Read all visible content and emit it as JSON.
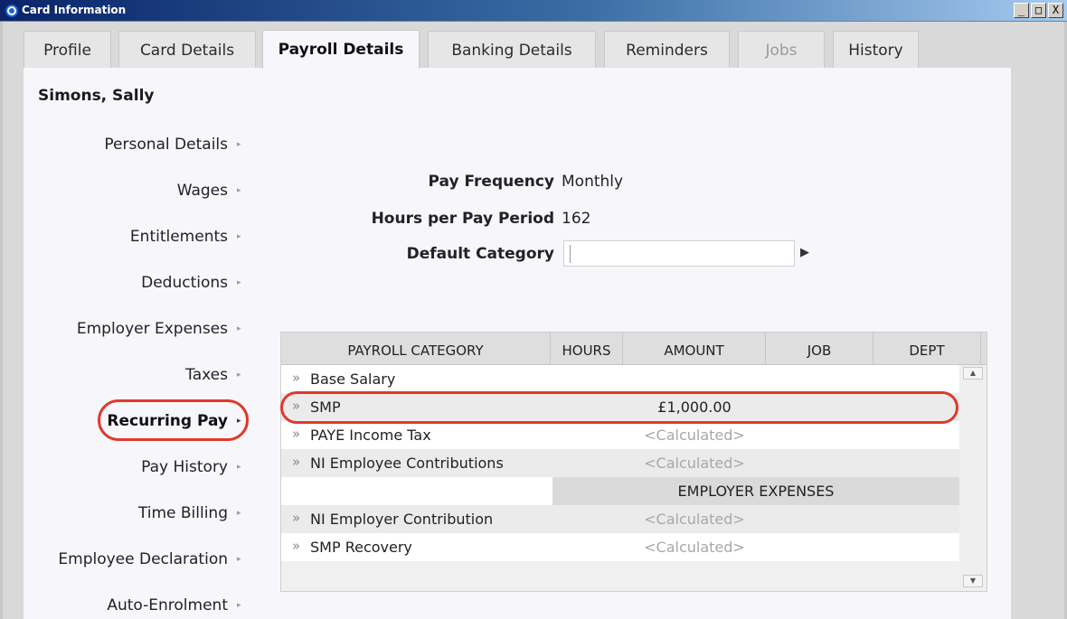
{
  "window": {
    "title": "Card Information",
    "buttons": {
      "minimize": "_",
      "maximize": "□",
      "close": "X"
    }
  },
  "tabs": [
    {
      "label": "Profile",
      "state": "normal"
    },
    {
      "label": "Card Details",
      "state": "normal"
    },
    {
      "label": "Payroll Details",
      "state": "active"
    },
    {
      "label": "Banking Details",
      "state": "normal"
    },
    {
      "label": "Reminders",
      "state": "normal"
    },
    {
      "label": "Jobs",
      "state": "disabled"
    },
    {
      "label": "History",
      "state": "normal"
    }
  ],
  "employee": {
    "name": "Simons, Sally"
  },
  "sidebar": {
    "items": [
      {
        "label": "Personal Details"
      },
      {
        "label": "Wages"
      },
      {
        "label": "Entitlements"
      },
      {
        "label": "Deductions"
      },
      {
        "label": "Employer Expenses"
      },
      {
        "label": "Taxes"
      },
      {
        "label": "Recurring Pay",
        "active": true
      },
      {
        "label": "Pay History"
      },
      {
        "label": "Time Billing"
      },
      {
        "label": "Employee Declaration"
      },
      {
        "label": "Auto-Enrolment"
      }
    ],
    "arrow_glyph": "▸"
  },
  "form": {
    "pay_frequency": {
      "label": "Pay Frequency",
      "value": "Monthly"
    },
    "hours_per_pay_period": {
      "label": "Hours per Pay Period",
      "value": "162"
    },
    "default_category": {
      "label": "Default Category",
      "value": ""
    }
  },
  "grid": {
    "columns": [
      "PAYROLL CATEGORY",
      "HOURS",
      "AMOUNT",
      "JOB",
      "DEPT"
    ],
    "rows": [
      {
        "category": "Base Salary",
        "amount": ""
      },
      {
        "category": "SMP",
        "amount": "£1,000.00"
      },
      {
        "category": "PAYE Income Tax",
        "amount": "<Calculated>"
      },
      {
        "category": "NI Employee Contributions",
        "amount": "<Calculated>"
      }
    ],
    "employer_section": {
      "title": "EMPLOYER EXPENSES",
      "rows": [
        {
          "category": "NI Employer Contribution",
          "amount": "<Calculated>"
        },
        {
          "category": "SMP Recovery",
          "amount": "<Calculated>"
        }
      ]
    },
    "row_icon": "»"
  },
  "colors": {
    "accent_highlight": "#e0392b",
    "title_bar_start": "#0a246a",
    "panel_background": "#f7f7fb"
  }
}
